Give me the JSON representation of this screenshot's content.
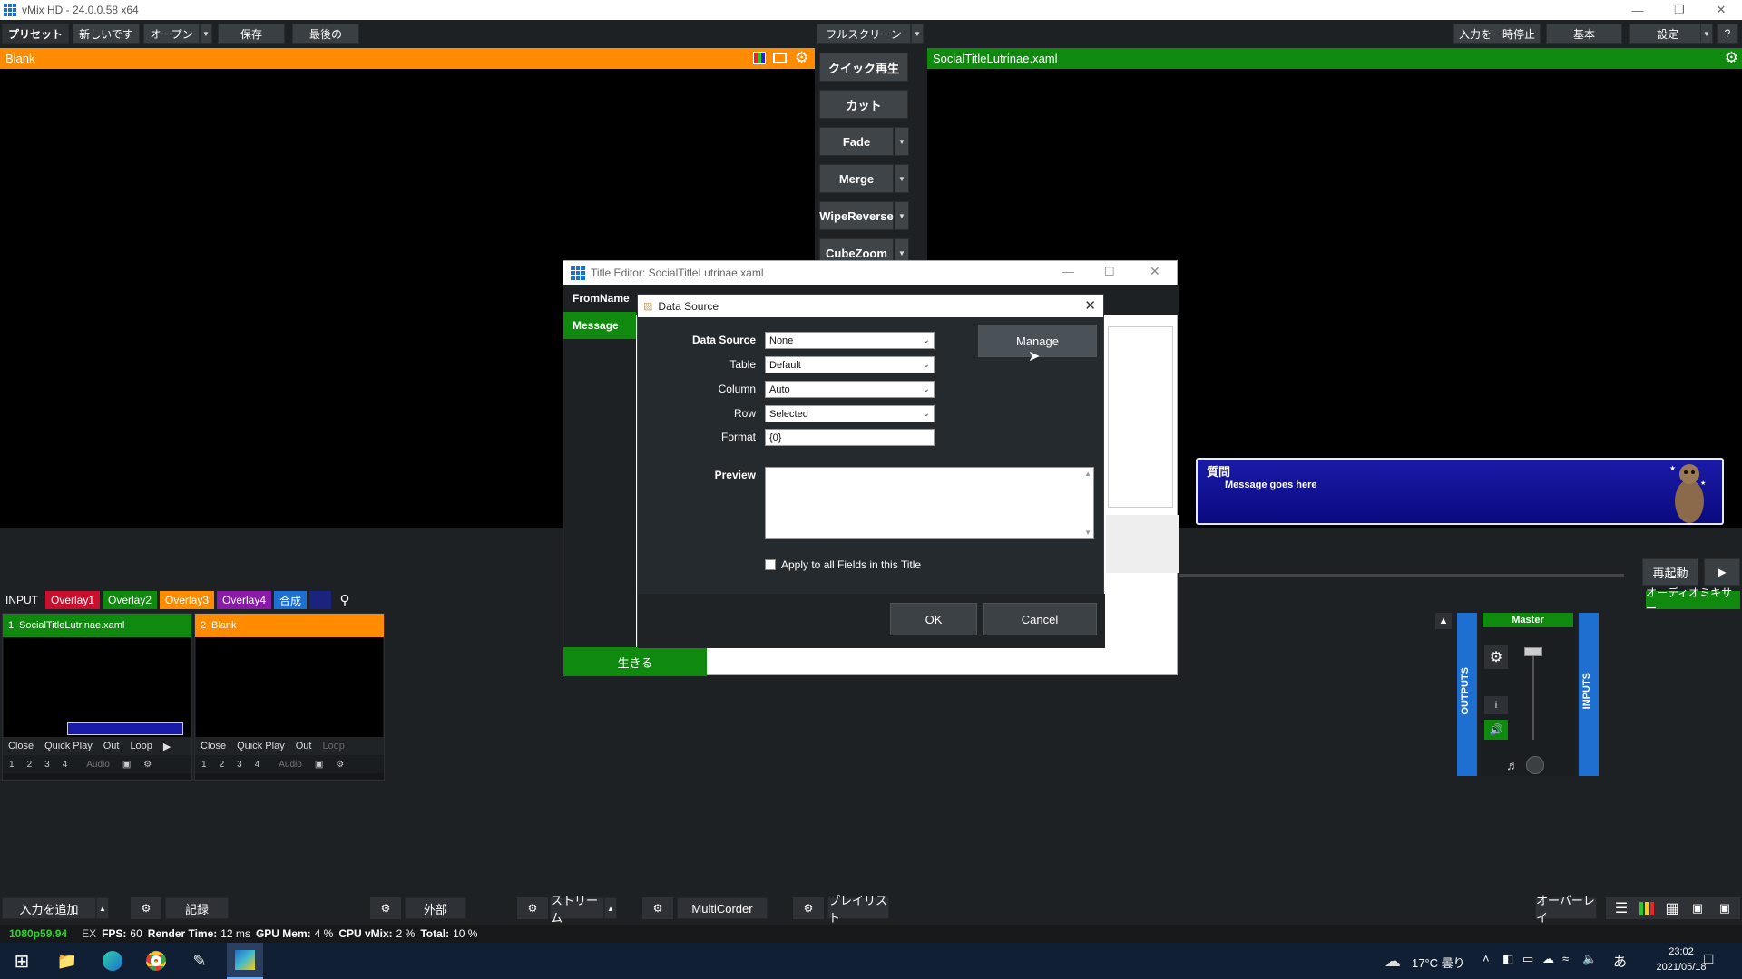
{
  "window": {
    "title": "vMix HD - 24.0.0.58 x64"
  },
  "toolbar": {
    "preset": "プリセット",
    "new": "新しいです",
    "open": "オープン",
    "save": "保存",
    "last": "最後の",
    "fullscreen": "フルスクリーン",
    "pause_input": "入力を一時停止",
    "basic": "基本",
    "settings": "設定",
    "help": "?"
  },
  "preview": {
    "label": "Blank"
  },
  "output": {
    "label": "SocialTitleLutrinae.xaml"
  },
  "transitions": {
    "quick_play": "クイック再生",
    "cut": "カット",
    "fade": "Fade",
    "merge": "Merge",
    "wipe": "WipeReverse",
    "cube": "CubeZoom"
  },
  "lower_third": {
    "name": "質問",
    "message": "Message goes here"
  },
  "output_controls": {
    "settings_btn": "設定",
    "restart": "再起動"
  },
  "input_tabs": {
    "input": "INPUT",
    "overlay1": "Overlay1",
    "overlay2": "Overlay2",
    "overlay3": "Overlay3",
    "overlay4": "Overlay4",
    "composite": "合成"
  },
  "inputs": [
    {
      "num": "1",
      "name": "SocialTitleLutrinae.xaml",
      "color": "#0f8a0f",
      "close": "Close",
      "quick_play": "Quick Play",
      "out": "Out",
      "loop": "Loop",
      "audio": "Audio"
    },
    {
      "num": "2",
      "name": "Blank",
      "color": "#ff8c00",
      "close": "Close",
      "quick_play": "Quick Play",
      "out": "Out",
      "loop": "Loop",
      "audio": "Audio"
    }
  ],
  "mixer": {
    "audio_mixer": "オーディオミキサー",
    "outputs": "OUTPUTS",
    "inputs": "INPUTS",
    "master": "Master"
  },
  "title_editor": {
    "title": "Title Editor: SocialTitleLutrinae.xaml",
    "fields": [
      "FromName",
      "Message"
    ],
    "live": "生きる"
  },
  "data_source": {
    "title": "Data Source",
    "labels": {
      "data_source": "Data Source",
      "table": "Table",
      "column": "Column",
      "row": "Row",
      "format": "Format",
      "preview": "Preview"
    },
    "values": {
      "data_source": "None",
      "table": "Default",
      "column": "Auto",
      "row": "Selected",
      "format": "{0}"
    },
    "manage": "Manage",
    "apply_all": "Apply to all Fields in this Title",
    "ok": "OK",
    "cancel": "Cancel"
  },
  "bottom": {
    "add_input": "入力を追加",
    "record": "記録",
    "external": "外部",
    "stream": "ストリーム",
    "multicorder": "MultiCorder",
    "playlist": "プレイリスト",
    "overlay": "オーバーレイ"
  },
  "status": {
    "format": "1080p59.94",
    "ex": "EX",
    "fps_label": "FPS:",
    "fps": "60",
    "render_label": "Render Time:",
    "render": "12 ms",
    "gpu_label": "GPU Mem:",
    "gpu": "4 %",
    "cpu_label": "CPU vMix:",
    "cpu": "2 %",
    "total_label": "Total:",
    "total": "10 %"
  },
  "taskbar": {
    "weather": "17°C 曇り",
    "ime": "あ",
    "time": "23:02",
    "date": "2021/05/18"
  },
  "colors": {
    "preview": "#ff8c00",
    "output": "#0f8a0f",
    "accent_blue": "#1e6fd0"
  }
}
